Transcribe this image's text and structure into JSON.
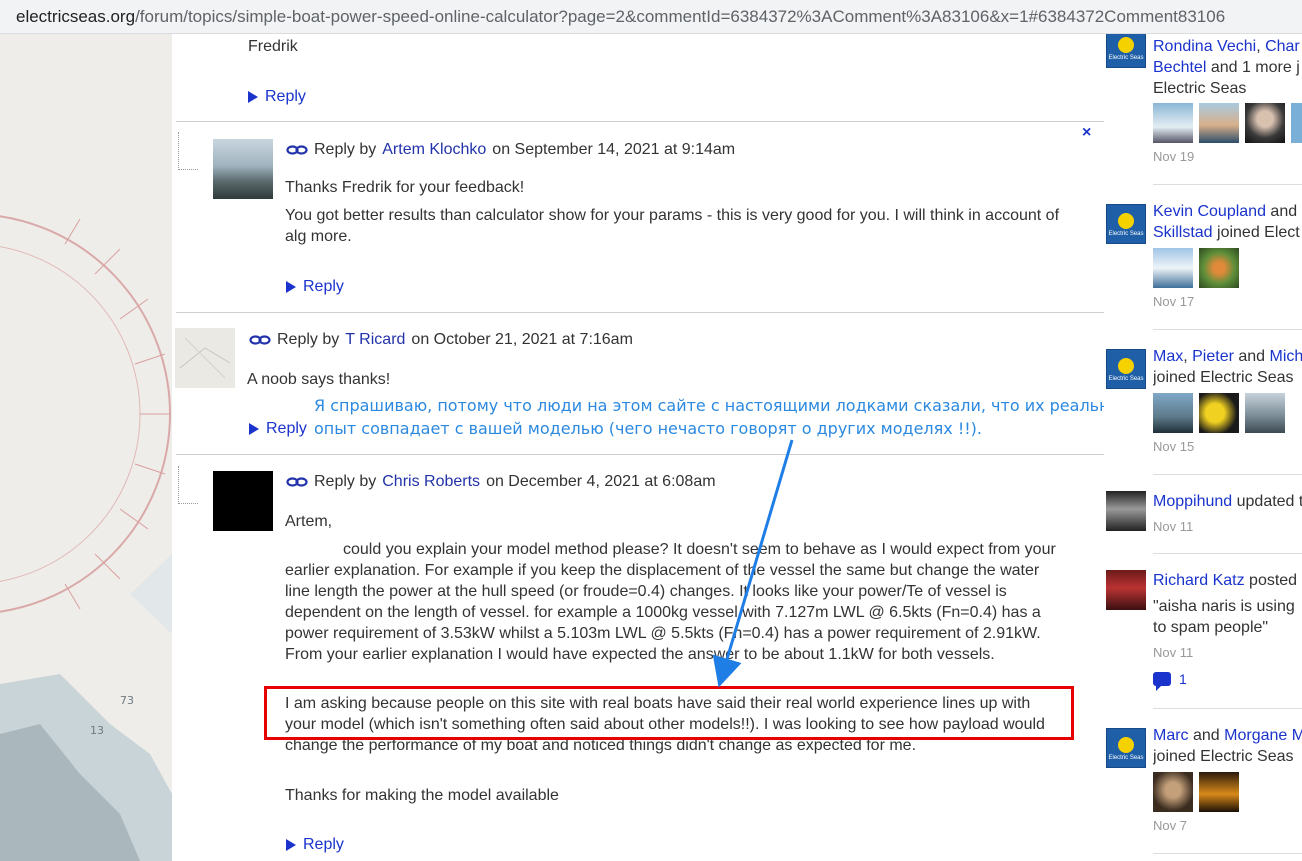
{
  "browser": {
    "url_host": "electricseas.org",
    "url_path": "/forum/topics/simple-boat-power-speed-online-calculator?page=2&commentId=6384372%3AComment%3A83106&x=1#6384372Comment83106"
  },
  "thread": {
    "prev_comment": {
      "signature": "Fredrik",
      "reply_label": "Reply"
    },
    "comments": [
      {
        "by_label": "Reply by",
        "author": "Artem Klochko",
        "date": "on September 14, 2021 at 9:14am",
        "paragraphs": [
          "Thanks Fredrik for your feedback!",
          "You got better results than calculator show for your params - this is very good for you. I will think in account of alg more."
        ],
        "reply_label": "Reply",
        "close_label": "×"
      },
      {
        "by_label": "Reply by",
        "author": "T Ricard",
        "date": "on October 21, 2021 at 7:16am",
        "paragraphs": [
          "A noob says thanks!"
        ],
        "reply_label": "Reply"
      },
      {
        "by_label": "Reply by",
        "author": "Chris Roberts",
        "date": "on December 4, 2021 at 6:08am",
        "greeting": "Artem,",
        "paragraphs": [
          "could you explain your model method please? It doesn't seem to behave as I would expect from your earlier explanation. For example if you keep the displacement of the vessel the same  but change the water line length the power at the hull speed (or froude=0.4) changes. It looks like your power/Te of vessel is dependent on the length of vessel.  for example a 1000kg vessel with 7.127m LWL @ 6.5kts (Fn=0.4) has a power requirement of 3.53kW whilst a 5.103m LWL @ 5.5kts (Fn=0.4) has a power requirement of 2.91kW. From your earlier explanation I would have expected the answer to be about 1.1kW for both vessels.",
          "I am asking because people on this site with real boats have said their real world experience lines up with your model (which isn't something often said about other models!!). I was looking to see how payload would change the performance of my boat and noticed things didn't change as expected for me.",
          "Thanks for making the model available"
        ],
        "reply_label": "Reply"
      }
    ]
  },
  "annotation": {
    "text": "Я спрашиваю, потому что люди на этом сайте с настоящими лодками сказали, что их реальный опыт совпадает с вашей моделью (чего нечасто говорят о других моделях !!).",
    "color": "#2b89e0",
    "highlight_color": "#e60000"
  },
  "sidebar": {
    "activities": [
      {
        "line1_links": [
          "Rondina Vechi",
          "Char"
        ],
        "line1_sep": ", ",
        "line2_link": "Bechtel",
        "line2_text": " and 1 more j",
        "line3": "Electric Seas",
        "date": "Nov 19"
      },
      {
        "line1_link": "Kevin Coupland",
        "line1_text": " and",
        "line2_link": "Skillstad",
        "line2_text": " joined Elect",
        "date": "Nov 17"
      },
      {
        "line1_links": [
          "Max",
          "Pieter",
          "Mich"
        ],
        "line1_text_a": ", ",
        "line1_text_b": " and ",
        "line2": "joined Electric Seas",
        "date": "Nov 15"
      },
      {
        "line1_link": "Moppihund",
        "line1_text": " updated t",
        "date": "Nov 11"
      },
      {
        "line1_link": "Richard Katz",
        "line1_text": " posted",
        "line2": "\"aisha naris is using",
        "line3": "to spam people\"",
        "date": "Nov 11",
        "comment_count": "1"
      },
      {
        "line1_links": [
          "Marc",
          "Morgane M"
        ],
        "line1_text": " and ",
        "line2": "joined Electric Seas",
        "date": "Nov 7"
      }
    ],
    "logo_text": "Electric Seas"
  }
}
